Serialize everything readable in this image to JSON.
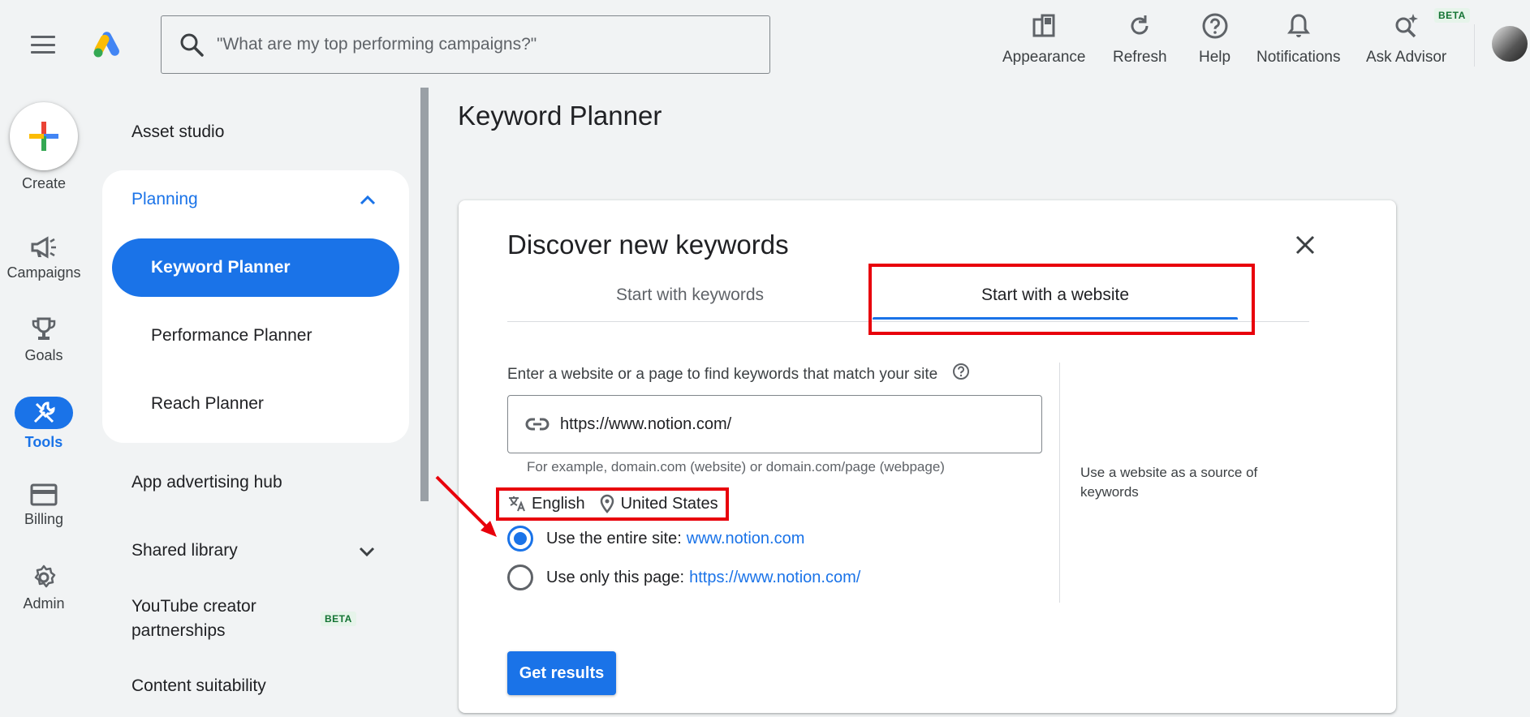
{
  "search": {
    "placeholder": "\"What are my top performing campaigns?\""
  },
  "toolbar": {
    "appearance": "Appearance",
    "refresh": "Refresh",
    "help": "Help",
    "notifications": "Notifications",
    "ask_advisor": "Ask Advisor",
    "beta": "BETA"
  },
  "rail": {
    "create": "Create",
    "campaigns": "Campaigns",
    "goals": "Goals",
    "tools": "Tools",
    "billing": "Billing",
    "admin": "Admin"
  },
  "nav": {
    "asset_studio": "Asset studio",
    "planning": "Planning",
    "keyword_planner": "Keyword Planner",
    "performance_planner": "Performance Planner",
    "reach_planner": "Reach Planner",
    "app_advertising_hub": "App advertising hub",
    "shared_library": "Shared library",
    "youtube_line1": "YouTube creator",
    "youtube_line2": "partnerships",
    "youtube_beta": "BETA",
    "content_suitability": "Content suitability"
  },
  "page": {
    "title": "Keyword Planner"
  },
  "dialog": {
    "title": "Discover new keywords",
    "tab_keywords": "Start with keywords",
    "tab_website": "Start with a website",
    "field_label": "Enter a website or a page to find keywords that match your site",
    "url_value": "https://www.notion.com/",
    "hint": "For example, domain.com (website) or domain.com/page (webpage)",
    "language": "English",
    "location": "United States",
    "option_entire_site": "Use the entire site:",
    "option_entire_site_link": "www.notion.com",
    "option_only_page": "Use only this page:",
    "option_only_page_link": "https://www.notion.com/",
    "side_note": "Use a website as a source of keywords",
    "get_results": "Get results"
  },
  "colors": {
    "accent": "#1a73e8",
    "highlight": "#e8000b",
    "background": "#f1f3f4"
  }
}
